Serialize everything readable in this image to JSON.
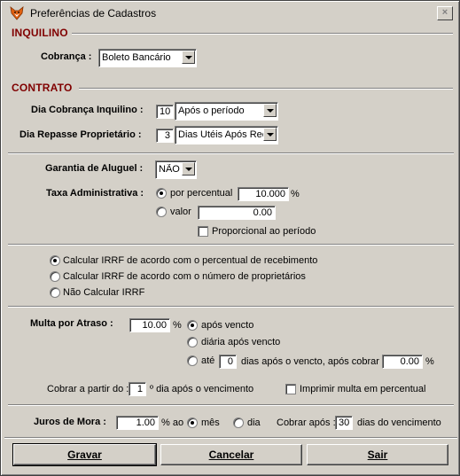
{
  "window": {
    "title": "Preferências de Cadastros",
    "close_symbol": "×"
  },
  "inquilino": {
    "section_title": "INQUILINO",
    "cobranca_label": "Cobrança :",
    "cobranca_value": "Boleto Bancário"
  },
  "contrato": {
    "section_title": "CONTRATO",
    "dia_cobranca_label": "Dia  Cobrança Inquilino :",
    "dia_cobranca_num": "10",
    "dia_cobranca_option": "Após o período",
    "dia_repasse_label": "Dia Repasse Proprietário :",
    "dia_repasse_num": "3",
    "dia_repasse_option": "Dias Utéis Após Rec"
  },
  "garantia": {
    "label": "Garantia de Aluguel :",
    "value": "NÃO"
  },
  "taxa": {
    "label": "Taxa Administrativa :",
    "percentual_label": "por percentual",
    "percentual_value": "10.000",
    "percent_sign": "%",
    "valor_label": "valor",
    "valor_value": "0.00",
    "proporcional_label": "Proporcional ao período"
  },
  "irrf": {
    "option1": "Calcular IRRF de acordo com o percentual de recebimento",
    "option2": "Calcular IRRF de acordo com o número de proprietários",
    "option3": "Não Calcular IRRF"
  },
  "multa": {
    "label": "Multa por  Atraso :",
    "value": "10.00",
    "percent_sign": "%",
    "apos_vencto": "após vencto",
    "diaria": "diária após vencto",
    "ate": "até",
    "ate_dias": "0",
    "dias_apos": "dias após o vencto, após cobrar",
    "cobrar_value": "0.00",
    "cobrar_percent": "%",
    "cobrar_partir_label": "Cobrar a partir do :",
    "cobrar_partir_value": "1",
    "cobrar_partir_suffix": "º dia após o vencimento",
    "imprimir_label": "Imprimir multa em percentual"
  },
  "juros": {
    "label": "Juros de Mora :",
    "value": "1.00",
    "ao": "% ao",
    "mes": "mês",
    "dia": "dia",
    "cobrar_apos_label": "Cobrar após :",
    "cobrar_apos_value": "30",
    "cobrar_apos_suffix": "dias do vencimento"
  },
  "buttons": {
    "gravar": "Gravar",
    "cancelar": "Cancelar",
    "sair": "Sair"
  }
}
